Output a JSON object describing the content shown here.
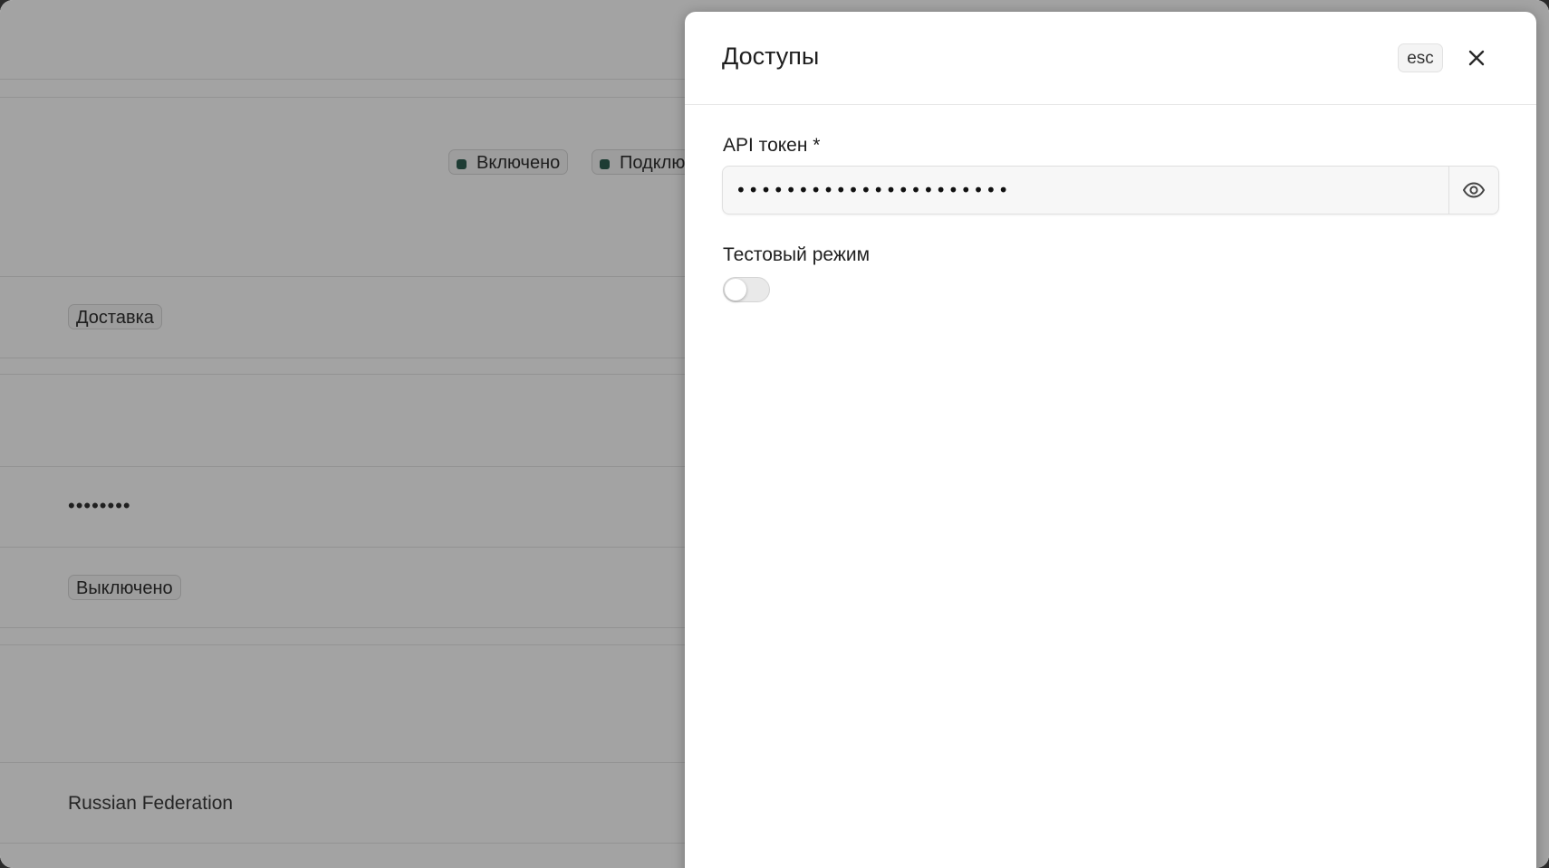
{
  "background": {
    "status_chips": [
      {
        "label": "Включено"
      },
      {
        "label": "Подклю"
      }
    ],
    "type_chip": "Доставка",
    "masked_value": "••••••••",
    "state_chip": "Выключено",
    "country": "Russian Federation"
  },
  "drawer": {
    "title": "Доступы",
    "esc_label": "esc",
    "api_token": {
      "label": "API токен *",
      "value": "••••••••••••••••••••••"
    },
    "test_mode": {
      "label": "Тестовый режим",
      "enabled": false
    }
  },
  "colors": {
    "overlay": "#000000",
    "status_dot": "#2f5e52"
  }
}
